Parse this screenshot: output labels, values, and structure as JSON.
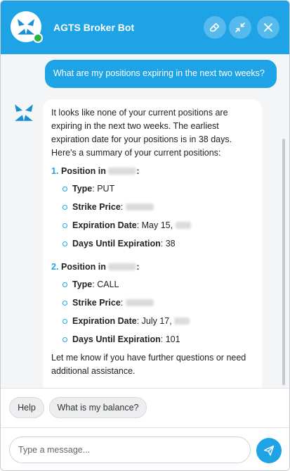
{
  "header": {
    "title": "AGTS Broker Bot",
    "accent": "#1ea3e6"
  },
  "chat": {
    "user_message": "What are my positions expiring in the next two weeks?",
    "bot": {
      "intro_lines": [
        "It looks like none of your current positions are",
        "expiring in the next two weeks. The earliest",
        "expiration date for your positions is in 38 days.",
        "Here's a summary of your current positions:"
      ],
      "positions": [
        {
          "num": "1.",
          "label": "Position in",
          "type_label": "Type",
          "type_value": "PUT",
          "strike_label": "Strike Price",
          "expiration_label": "Expiration Date",
          "expiration_value": "May 15,",
          "days_label": "Days Until Expiration",
          "days_value": "38"
        },
        {
          "num": "2.",
          "label": "Position in",
          "type_label": "Type",
          "type_value": "CALL",
          "strike_label": "Strike Price",
          "expiration_label": "Expiration Date",
          "expiration_value": "July 17,",
          "days_label": "Days Until Expiration",
          "days_value": "101"
        }
      ],
      "closing_lines": [
        "Let me know if you have further questions or need",
        "additional assistance."
      ]
    }
  },
  "suggestions": [
    "Help",
    "What is my balance?"
  ],
  "composer": {
    "placeholder": "Type a message..."
  }
}
